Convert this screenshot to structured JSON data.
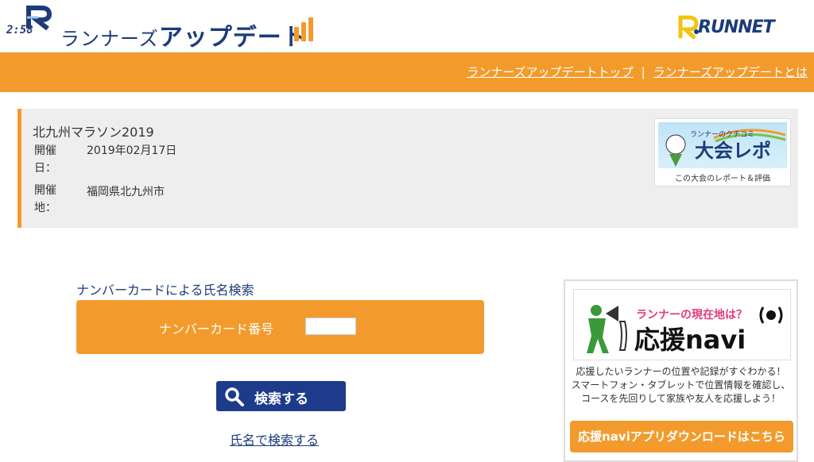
{
  "header": {
    "clock": "2:58",
    "logo_small": "ランナーズ",
    "logo_big": "アップデート",
    "runnet": "RUNNET"
  },
  "nav": {
    "top_link": "ランナーズアップデートトップ",
    "separator": "|",
    "about_link": "ランナーズアップデートとは"
  },
  "event": {
    "title": "北九州マラソン2019",
    "date_label": "開催日：",
    "date_value": "2019年02月17日",
    "place_label": "開催地：",
    "place_value": "福岡県北九州市",
    "report_tag": "ランナーのクチコミ",
    "report_title": "大会レポ",
    "report_caption": "この大会のレポート＆評価"
  },
  "search": {
    "heading": "ナンバーカードによる氏名検索",
    "number_label": "ナンバーカード番号",
    "number_value": "",
    "button": "検索する",
    "name_search_link": "氏名で検索する"
  },
  "navi": {
    "tagline": "ランナーの現在地は？",
    "title": "応援navi",
    "desc_line1": "応援したいランナーの位置や記録がすぐわかる！",
    "desc_line2": "スマートフォン・タブレットで位置情報を確認し、",
    "desc_line3": "コースを先回りして家族や友人を応援しよう！",
    "button": "応援naviアプリダウンロードはこちら"
  },
  "colors": {
    "accent": "#f29b2c",
    "brand": "#1d3b7a",
    "button": "#1d3b8a"
  }
}
